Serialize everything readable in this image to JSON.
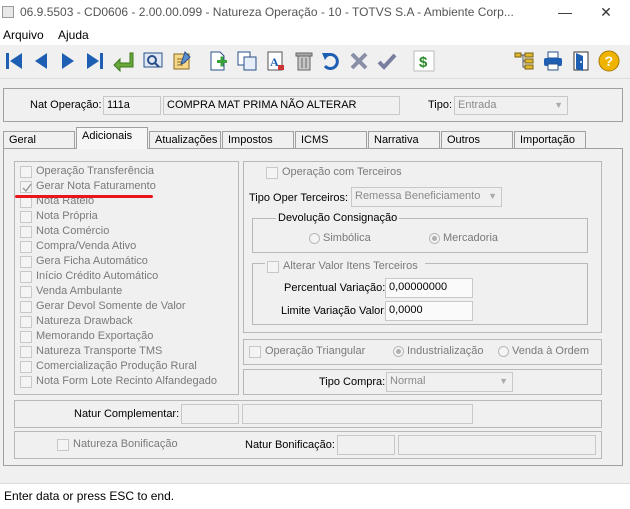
{
  "window": {
    "title": "06.9.5503 - CD0606 - 2.00.00.099 - Natureza Operação - 10 - TOTVS S.A - Ambiente Corp...",
    "minimize_glyph": "—",
    "close_glyph": "✕"
  },
  "menu": {
    "items": [
      "Arquivo",
      "Ajuda"
    ]
  },
  "toolbar": {
    "icons": [
      "first-icon",
      "prev-icon",
      "next-icon",
      "last-icon",
      "goto-icon",
      "zoom-icon",
      "edit-icon",
      "new-icon",
      "copy-icon",
      "replace-icon",
      "delete-icon",
      "undo-icon",
      "cancel-icon",
      "ok-icon",
      "dollar-icon",
      "tree-icon",
      "print-icon",
      "exit-icon",
      "help-icon"
    ],
    "accent": "#1e5fb4"
  },
  "header": {
    "nat_label": "Nat Operação:",
    "nat_code": "111a",
    "nat_desc": "COMPRA MAT PRIMA NÃO ALTERAR",
    "tipo_label": "Tipo:",
    "tipo_value": "Entrada"
  },
  "tabs": [
    {
      "label": "Geral",
      "active": false
    },
    {
      "label": "Adicionais",
      "active": true
    },
    {
      "label": "Atualizações",
      "active": false
    },
    {
      "label": "Impostos",
      "active": false
    },
    {
      "label": "ICMS",
      "active": false
    },
    {
      "label": "Narrativa",
      "active": false
    },
    {
      "label": "Outros",
      "active": false
    },
    {
      "label": "Importação",
      "active": false
    }
  ],
  "checkboxes": [
    {
      "label": "Operação Transferência",
      "checked": false
    },
    {
      "label": "Gerar Nota Faturamento",
      "checked": true
    },
    {
      "label": "Nota Rateio",
      "checked": false
    },
    {
      "label": "Nota Própria",
      "checked": false
    },
    {
      "label": "Nota Comércio",
      "checked": false
    },
    {
      "label": "Compra/Venda Ativo",
      "checked": false
    },
    {
      "label": "Gera Ficha Automático",
      "checked": false
    },
    {
      "label": "Início Crédito Automático",
      "checked": false
    },
    {
      "label": "Venda Ambulante",
      "checked": false
    },
    {
      "label": "Gerar Devol Somente de Valor",
      "checked": false
    },
    {
      "label": "Natureza Drawback",
      "checked": false
    },
    {
      "label": "Memorando Exportação",
      "checked": false
    },
    {
      "label": "Natureza Transporte TMS",
      "checked": false
    },
    {
      "label": "Comercialização Produção Rural",
      "checked": false
    },
    {
      "label": "Nota Form Lote Recinto Alfandegado",
      "checked": false
    }
  ],
  "terceiros": {
    "op_terceiros_label": "Operação com Terceiros",
    "tipo_oper_label": "Tipo Oper Terceiros:",
    "tipo_oper_value": "Remessa Beneficiamento",
    "devolucao_title": "Devolução Consignação",
    "radio_simbolica": "Simbólica",
    "radio_mercadoria": "Mercadoria",
    "alterar_label": "Alterar Valor Itens Terceiros",
    "percentual_label": "Percentual Variação:",
    "percentual_value": "0,00000000",
    "limite_label": "Limite Variação Valor:",
    "limite_value": "0,0000"
  },
  "triangular": {
    "label": "Operação Triangular",
    "radio_industrializacao": "Industrialização",
    "radio_venda": "Venda à Ordem"
  },
  "tipo_compra": {
    "label": "Tipo Compra:",
    "value": "Normal"
  },
  "complementar": {
    "label": "Natur Complementar:"
  },
  "bonificacao": {
    "check_label": "Natureza Bonificação",
    "natur_label": "Natur Bonificação:"
  },
  "status": {
    "text": "Enter data or press ESC to end."
  },
  "annotation": {
    "color": "#e8161b"
  }
}
